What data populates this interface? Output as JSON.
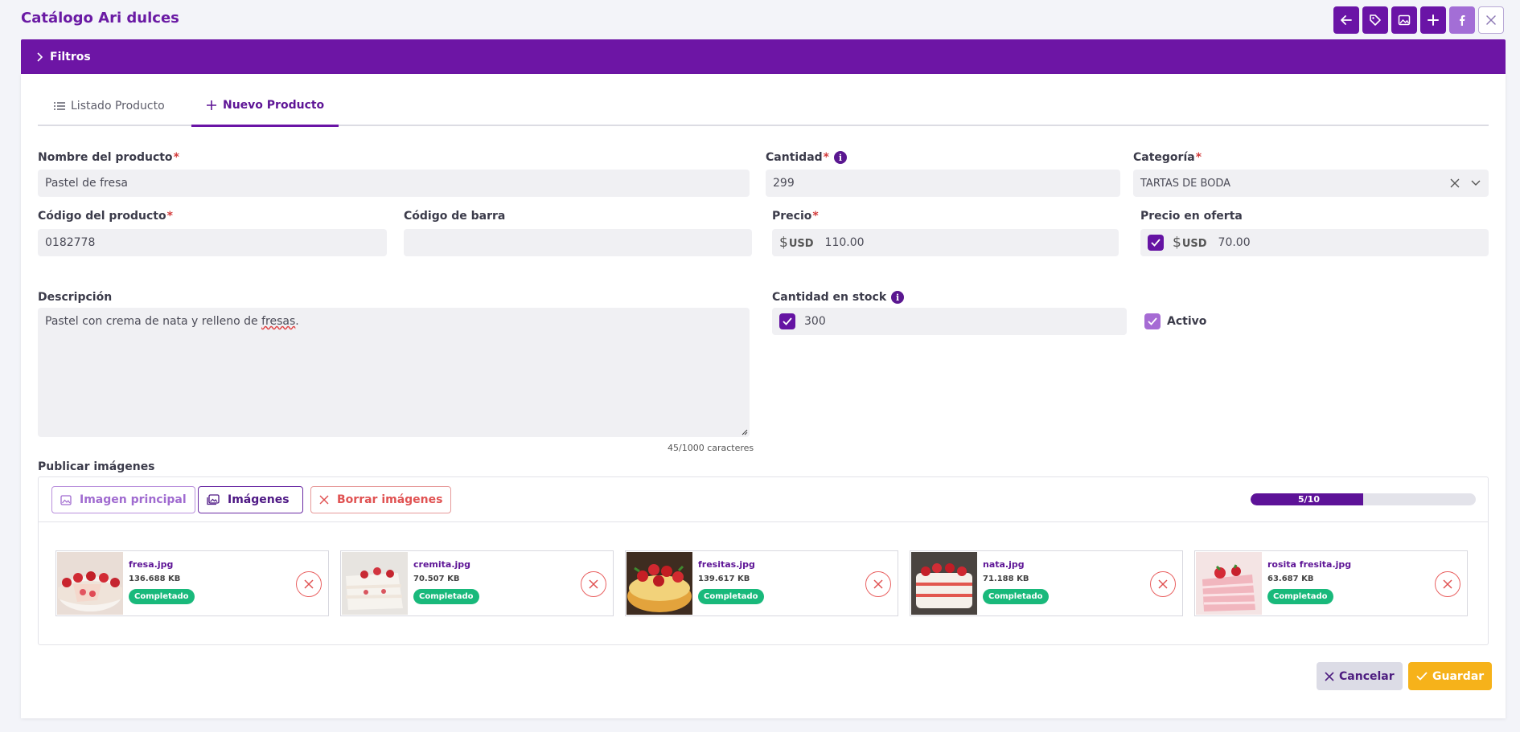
{
  "app": {
    "title": "Catálogo Ari dulces"
  },
  "toolbar": {
    "buttons": [
      {
        "icon": "arrow-left-icon"
      },
      {
        "icon": "tag-icon"
      },
      {
        "icon": "image-icon"
      },
      {
        "icon": "plus-icon"
      },
      {
        "icon": "facebook-icon"
      },
      {
        "icon": "close-icon"
      }
    ]
  },
  "filters": {
    "label": "Filtros"
  },
  "tabs": [
    {
      "label": "Listado Producto",
      "icon": "list-icon",
      "active": false
    },
    {
      "label": "Nuevo Producto",
      "icon": "plus-icon",
      "active": true
    }
  ],
  "form": {
    "nombre": {
      "label": "Nombre del producto",
      "required": "*",
      "value": "Pastel de fresa"
    },
    "cantidad": {
      "label": "Cantidad",
      "required": "*",
      "info": "i",
      "value": "299"
    },
    "categoria": {
      "label": "Categoría",
      "required": "*",
      "value": "TARTAS DE BODA"
    },
    "codigo": {
      "label": "Código del producto",
      "required": "*",
      "value": "0182778"
    },
    "codigo_barra": {
      "label": "Código de barra",
      "value": ""
    },
    "precio": {
      "label": "Precio",
      "required": "*",
      "symbol": "$",
      "currency": "USD",
      "value": "110.00"
    },
    "precio_oferta": {
      "label": "Precio en oferta",
      "checked": true,
      "symbol": "$",
      "currency": "USD",
      "value": "70.00"
    },
    "descripcion": {
      "label": "Descripción",
      "value_start": "Pastel con crema de nata y relleno de ",
      "value_marked": "fresas",
      "value_end": ".",
      "counter": "45/1000 caracteres"
    },
    "stock": {
      "label": "Cantidad en stock",
      "info": "i",
      "checked": true,
      "value": "300"
    },
    "activo": {
      "label": "Activo",
      "checked": true
    }
  },
  "images": {
    "section_label": "Publicar imágenes",
    "btn_principal": "Imagen principal",
    "btn_imagenes": "Imágenes",
    "btn_borrar": "Borrar imágenes",
    "progress_text": "5/10",
    "progress_value": 0.5,
    "files": [
      {
        "name": "fresa.jpg",
        "size": "136.688 KB",
        "status": "Completado"
      },
      {
        "name": "cremita.jpg",
        "size": "70.507 KB",
        "status": "Completado"
      },
      {
        "name": "fresitas.jpg",
        "size": "139.617 KB",
        "status": "Completado"
      },
      {
        "name": "nata.jpg",
        "size": "71.188 KB",
        "status": "Completado"
      },
      {
        "name": "rosita fresita.jpg",
        "size": "63.687 KB",
        "status": "Completado"
      }
    ]
  },
  "actions": {
    "cancel": "Cancelar",
    "save": "Guardar"
  },
  "colors": {
    "primary": "#6d15a5",
    "accent": "#f6b21a",
    "success": "#19b97b",
    "danger": "#e05252"
  }
}
